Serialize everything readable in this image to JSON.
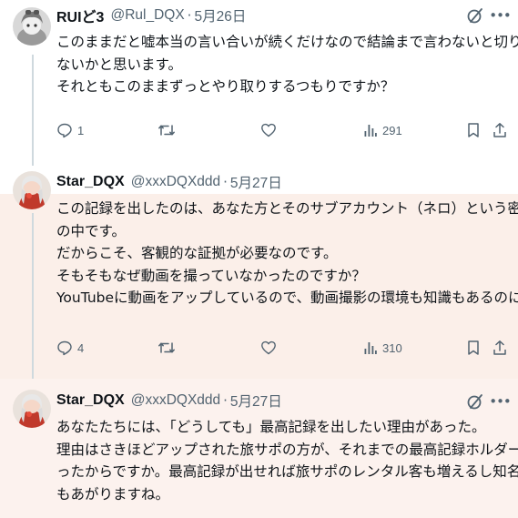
{
  "tweets": [
    {
      "name": "RUIど3",
      "handle": "@Rul_DQX",
      "separator": "·",
      "date": "5月26日",
      "lines": [
        "このままだと嘘本当の言い合いが続くだけなので結論まで言わないと切りが",
        "ないかと思います。",
        "それともこのままずっとやり取りするつもりですか？"
      ],
      "reply_count": "1",
      "retweet_count": "",
      "like_count": "",
      "views_count": "291"
    },
    {
      "name": "Star_DQX",
      "handle": "@xxxDQXddd",
      "separator": "·",
      "date": "5月27日",
      "lines": [
        "この記録を出したのは、あなた方とそのサブアカウント（ネロ）という密室",
        "の中です。",
        "だからこそ、客観的な証拠が必要なのです。",
        "そもそもなぜ動画を撮っていなかったのですか？",
        "YouTubeに動画をアップしているので、動画撮影の環境も知識もあるのに。"
      ],
      "reply_count": "4",
      "retweet_count": "",
      "like_count": "",
      "views_count": "310"
    },
    {
      "name": "Star_DQX",
      "handle": "@xxxDQXddd",
      "separator": "·",
      "date": "5月27日",
      "lines": [
        "あなたたちには、「どうしても」最高記録を出したい理由があった。",
        "理由はさきほどアップされた旅サポの方が、それまでの最高記録ホルダーだ",
        "ったからですか。最高記録が出せれば旅サポのレンタル客も増えるし知名度",
        "もあがりますね。"
      ]
    }
  ],
  "icons": {
    "reply": "reply-icon",
    "retweet": "retweet-icon",
    "like": "heart-icon",
    "views": "views-icon",
    "bookmark": "bookmark-icon",
    "share": "share-icon",
    "grok": "grok-icon",
    "more": "more-icon"
  },
  "colors": {
    "text": "#0f1419",
    "muted": "#536471",
    "highlight_bg": "#fbefe9",
    "thread_line": "#cfd9de"
  }
}
